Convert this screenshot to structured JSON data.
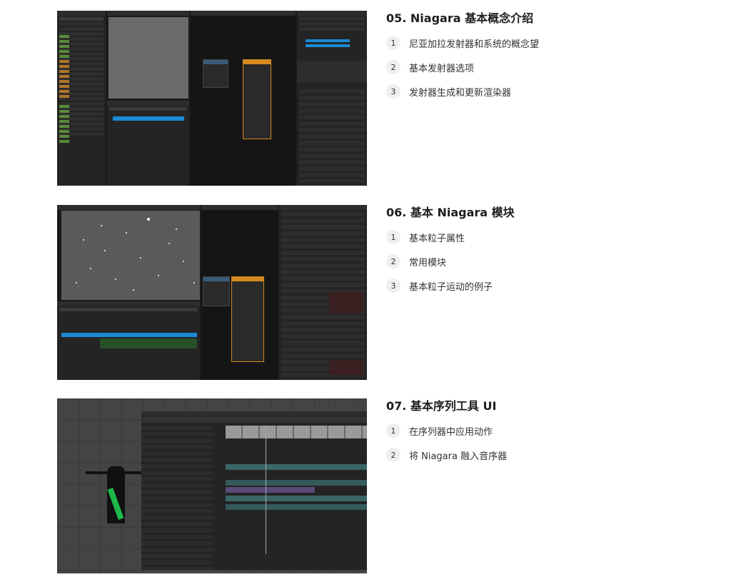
{
  "sections": [
    {
      "title": "05. Niagara 基本概念介绍",
      "items": [
        {
          "num": "1",
          "text": "尼亚加拉发射器和系统的概念望"
        },
        {
          "num": "2",
          "text": "基本发射器选项"
        },
        {
          "num": "3",
          "text": "发射器生成和更新渲染器"
        }
      ],
      "screenshot": "niagara-editor-system-overview"
    },
    {
      "title": "06. 基本 Niagara 模块",
      "items": [
        {
          "num": "1",
          "text": "基本粒子属性"
        },
        {
          "num": "2",
          "text": "常用模块"
        },
        {
          "num": "3",
          "text": "基本粒子运动的例子"
        }
      ],
      "screenshot": "niagara-editor-particle-preview"
    },
    {
      "title": "07. 基本序列工具 UI",
      "items": [
        {
          "num": "1",
          "text": "在序列器中应用动作"
        },
        {
          "num": "2",
          "text": "将 Niagara 融入音序器"
        }
      ],
      "screenshot": "sequencer-editor-character"
    }
  ]
}
